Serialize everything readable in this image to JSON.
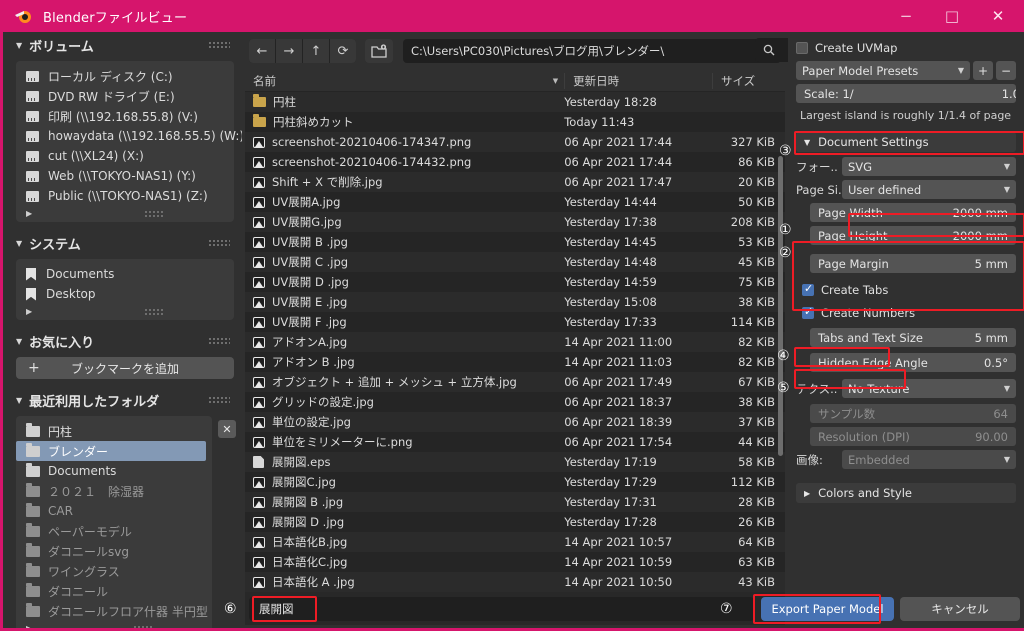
{
  "window": {
    "title": "Blenderファイルビュー",
    "app_icon": "blender-logo-icon",
    "minimize": "−",
    "maximize": "□",
    "close": "✕",
    "accent_color": "#d6156c"
  },
  "sidebar": {
    "sections": [
      {
        "title": "ボリューム",
        "items": [
          {
            "label": "ローカル ディスク (C:)",
            "icon": "drive-icon"
          },
          {
            "label": "DVD RW ドライブ (E:)",
            "icon": "drive-icon"
          },
          {
            "label": "印刷 (\\\\192.168.55.8) (V:)",
            "icon": "drive-icon"
          },
          {
            "label": "howaydata (\\\\192.168.55.5) (W:)",
            "icon": "drive-icon"
          },
          {
            "label": "cut (\\\\XL24) (X:)",
            "icon": "drive-icon"
          },
          {
            "label": "Web (\\\\TOKYO-NAS1) (Y:)",
            "icon": "drive-icon"
          },
          {
            "label": "Public (\\\\TOKYO-NAS1) (Z:)",
            "icon": "drive-icon"
          }
        ]
      },
      {
        "title": "システム",
        "items": [
          {
            "label": "Documents",
            "icon": "bookmark-icon"
          },
          {
            "label": "Desktop",
            "icon": "bookmark-icon"
          }
        ]
      },
      {
        "title": "お気に入り",
        "add_bookmark_label": "ブックマークを追加",
        "add_icon": "plus-icon"
      },
      {
        "title": "最近利用したフォルダ",
        "clear_icon": "close-icon",
        "items": [
          {
            "label": "円柱",
            "selected": false,
            "dim": false
          },
          {
            "label": "ブレンダー",
            "selected": true,
            "dim": false
          },
          {
            "label": "Documents",
            "selected": false,
            "dim": false
          },
          {
            "label": "２０２１　除湿器",
            "selected": false,
            "dim": true
          },
          {
            "label": "CAR",
            "selected": false,
            "dim": true
          },
          {
            "label": "ペーパーモデル",
            "selected": false,
            "dim": true
          },
          {
            "label": "ダコニールsvg",
            "selected": false,
            "dim": true
          },
          {
            "label": "ワイングラス",
            "selected": false,
            "dim": true
          },
          {
            "label": "ダコニール",
            "selected": false,
            "dim": true
          },
          {
            "label": "ダコニールフロア什器 半円型",
            "selected": false,
            "dim": true
          }
        ]
      }
    ]
  },
  "toolbar": {
    "back_icon": "arrow-left-icon",
    "forward_icon": "arrow-right-icon",
    "up_icon": "arrow-up-icon",
    "refresh_icon": "refresh-icon",
    "new_folder_icon": "new-folder-icon",
    "path": "C:\\Users\\PC030\\Pictures\\ブログ用\\ブレンダー\\",
    "search_icon": "search-icon",
    "search_value": "",
    "display_mode_icon": "list-view-icon",
    "filter_icon": "filter-icon",
    "settings_icon": "gear-icon",
    "chevron_icon": "chevron-down-icon"
  },
  "filelist": {
    "columns": {
      "name": "名前",
      "date": "更新日時",
      "size": "サイズ"
    },
    "sort_caret": "▼",
    "rows": [
      {
        "name": "円柱",
        "date": "Yesterday 18:28",
        "size": "",
        "icon": "folder-icon"
      },
      {
        "name": "円柱斜めカット",
        "date": "Today 11:43",
        "size": "",
        "icon": "folder-icon"
      },
      {
        "name": "screenshot-20210406-174347.png",
        "date": "06 Apr 2021 17:44",
        "size": "327 KiB",
        "icon": "image-icon"
      },
      {
        "name": "screenshot-20210406-174432.png",
        "date": "06 Apr 2021 17:44",
        "size": "86 KiB",
        "icon": "image-icon"
      },
      {
        "name": "Shift + X で削除.jpg",
        "date": "06 Apr 2021 17:47",
        "size": "20 KiB",
        "icon": "image-icon"
      },
      {
        "name": "UV展開A.jpg",
        "date": "Yesterday 14:44",
        "size": "50 KiB",
        "icon": "image-icon"
      },
      {
        "name": "UV展開G.jpg",
        "date": "Yesterday 17:38",
        "size": "208 KiB",
        "icon": "image-icon"
      },
      {
        "name": "UV展開 B .jpg",
        "date": "Yesterday 14:45",
        "size": "53 KiB",
        "icon": "image-icon"
      },
      {
        "name": "UV展開 C .jpg",
        "date": "Yesterday 14:48",
        "size": "45 KiB",
        "icon": "image-icon"
      },
      {
        "name": "UV展開 D .jpg",
        "date": "Yesterday 14:59",
        "size": "75 KiB",
        "icon": "image-icon"
      },
      {
        "name": "UV展開 E .jpg",
        "date": "Yesterday 15:08",
        "size": "38 KiB",
        "icon": "image-icon"
      },
      {
        "name": "UV展開 F .jpg",
        "date": "Yesterday 17:33",
        "size": "114 KiB",
        "icon": "image-icon"
      },
      {
        "name": "アドオンA.jpg",
        "date": "14 Apr 2021 11:00",
        "size": "82 KiB",
        "icon": "image-icon"
      },
      {
        "name": "アドオン B .jpg",
        "date": "14 Apr 2021 11:03",
        "size": "82 KiB",
        "icon": "image-icon"
      },
      {
        "name": "オブジェクト + 追加 + メッシュ + 立方体.jpg",
        "date": "06 Apr 2021 17:49",
        "size": "67 KiB",
        "icon": "image-icon"
      },
      {
        "name": "グリッドの設定.jpg",
        "date": "06 Apr 2021 18:37",
        "size": "38 KiB",
        "icon": "image-icon"
      },
      {
        "name": "単位の設定.jpg",
        "date": "06 Apr 2021 18:39",
        "size": "37 KiB",
        "icon": "image-icon"
      },
      {
        "name": "単位をミリメーターに.png",
        "date": "06 Apr 2021 17:54",
        "size": "44 KiB",
        "icon": "image-icon"
      },
      {
        "name": "展開図.eps",
        "date": "Yesterday 17:19",
        "size": "58 KiB",
        "icon": "eps-icon"
      },
      {
        "name": "展開図C.jpg",
        "date": "Yesterday 17:29",
        "size": "112 KiB",
        "icon": "image-icon"
      },
      {
        "name": "展開図 B .jpg",
        "date": "Yesterday 17:31",
        "size": "28 KiB",
        "icon": "image-icon"
      },
      {
        "name": "展開図 D .jpg",
        "date": "Yesterday 17:28",
        "size": "26 KiB",
        "icon": "image-icon"
      },
      {
        "name": "日本語化B.jpg",
        "date": "14 Apr 2021 10:57",
        "size": "64 KiB",
        "icon": "image-icon"
      },
      {
        "name": "日本語化C.jpg",
        "date": "14 Apr 2021 10:59",
        "size": "63 KiB",
        "icon": "image-icon"
      },
      {
        "name": "日本語化 A .jpg",
        "date": "14 Apr 2021 10:50",
        "size": "43 KiB",
        "icon": "image-icon"
      }
    ]
  },
  "properties": {
    "create_uvmap": {
      "label": "Create UVMap",
      "checked": false
    },
    "presets": {
      "value": "Paper Model Presets",
      "add": "+",
      "remove": "−"
    },
    "scale": {
      "label": "Scale: 1/",
      "value": "1.0"
    },
    "scale_hint": "Largest island is roughly 1/1.4 of page",
    "document_settings": {
      "title": "Document Settings",
      "caret": "▼"
    },
    "format": {
      "label": "フォー..",
      "value": "SVG"
    },
    "page_size": {
      "label": "Page Si..",
      "value": "User defined"
    },
    "page_width": {
      "label": "Page Width",
      "value": "2000 mm"
    },
    "page_height": {
      "label": "Page Height",
      "value": "2000 mm"
    },
    "page_margin": {
      "label": "Page Margin",
      "value": "5 mm"
    },
    "create_tabs": {
      "label": "Create Tabs",
      "checked": true
    },
    "create_numbers": {
      "label": "Create Numbers",
      "checked": true
    },
    "tabs_text_size": {
      "label": "Tabs and Text Size",
      "value": "5 mm"
    },
    "hidden_edge_angle": {
      "label": "Hidden Edge Angle",
      "value": "0.5°"
    },
    "texture": {
      "label": "テクス..",
      "value": "No Texture"
    },
    "samples": {
      "label": "サンプル数",
      "value": "64"
    },
    "resolution": {
      "label": "Resolution (DPI)",
      "value": "90.00"
    },
    "image": {
      "label": "画像:",
      "value": "Embedded"
    },
    "colors_and_style": {
      "title": "Colors and Style",
      "caret": "▶"
    }
  },
  "bottom": {
    "filename": "展開図",
    "export_label": "Export Paper Model",
    "cancel_label": "キャンセル"
  },
  "annotations": {
    "markers": [
      "①",
      "②",
      "③",
      "④",
      "⑤",
      "⑥",
      "⑦"
    ],
    "box_color": "#ee1c25"
  }
}
